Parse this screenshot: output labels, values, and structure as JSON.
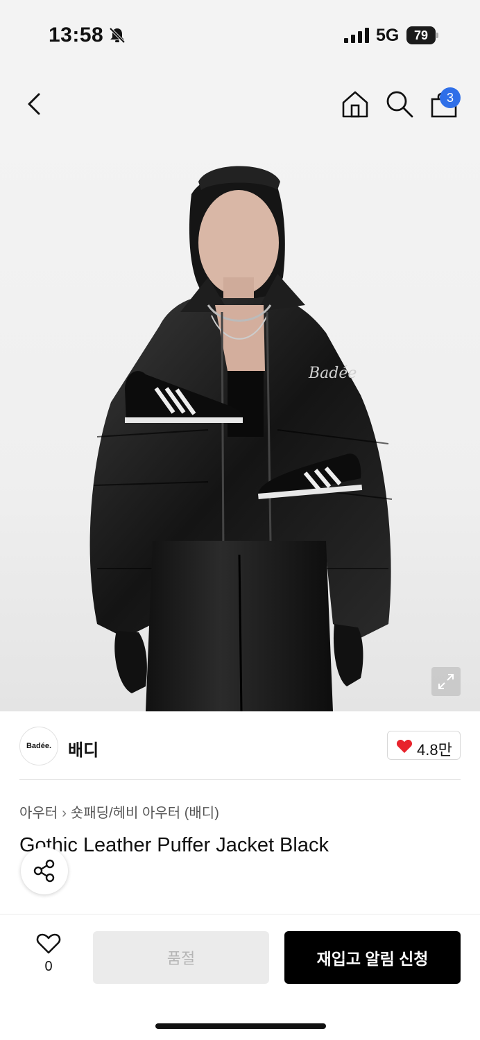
{
  "status_bar": {
    "time": "13:58",
    "network": "5G",
    "battery": "79"
  },
  "nav": {
    "cart_count": "3",
    "accent_color": "#2f6fe8"
  },
  "brand": {
    "logo_text": "Badée.",
    "name": "배디",
    "likes": "4.8만"
  },
  "product": {
    "breadcrumb": [
      "아우터",
      "숏패딩/헤비 아우터 (배디)"
    ],
    "title": "Gothic Leather Puffer Jacket Black"
  },
  "bottom_bar": {
    "wish_count": "0",
    "soldout_label": "품절",
    "restock_label": "재입고 알림 신청"
  }
}
